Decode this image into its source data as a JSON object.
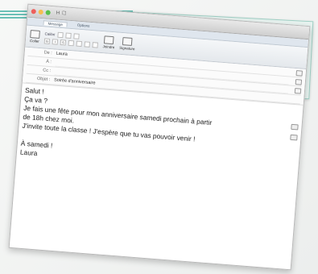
{
  "mail": {
    "title_tools": {
      "save": "H",
      "paperclip": "☐"
    },
    "tabs": {
      "message": "Message",
      "options": "Options"
    },
    "ribbon": {
      "paste": "Coller",
      "font": "Calibri",
      "bold": "G",
      "italic": "I",
      "underline": "S",
      "attachment": "Joindre",
      "signature": "Signature"
    },
    "fields": {
      "to_label": "De :",
      "to_value": "Laura",
      "a_label": "À :",
      "cc_label": "Cc :",
      "subject_label": "Objet :",
      "subject_value": "Soirée d'anniversaire"
    },
    "body": {
      "line1": "Salut !",
      "line2": "Ça va ?",
      "line3": "Je fais une fête pour mon anniversaire samedi prochain à partir",
      "line4": "de 18h chez moi.",
      "line5": "J'invite toute la classe ! J'espère que tu vas pouvoir venir !",
      "line6": "À samedi !",
      "line7": "Laura"
    }
  }
}
